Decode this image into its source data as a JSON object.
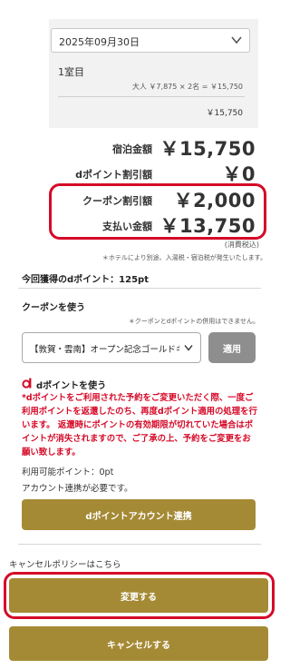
{
  "stay": {
    "date": "2025年09月30日",
    "room": "1室目",
    "price_detail": "大人 ￥7,875 × 2名 = ￥15,750",
    "subtotal": "￥15,750"
  },
  "totals": {
    "accommodation_label": "宿泊金額",
    "accommodation_value": "￥15,750",
    "dpoint_discount_label": "dポイント割引額",
    "dpoint_discount_value": "￥0",
    "coupon_discount_label": "クーポン割引額",
    "coupon_discount_value": "￥2,000",
    "payment_label": "支払い金額",
    "payment_value": "￥13,750",
    "tax_note": "(消費税込)",
    "hotel_note": "＊ホテルにより別途、入湯税・宿泊税が発生いたします。"
  },
  "points_earned": "今回獲得のdポイント：125pt",
  "coupon": {
    "title": "クーポンを使う",
    "note": "＊クーポンとdポイントの併用はできません。",
    "selected": "【敦賀・雲南】オープン記念ゴールドキャンペーン",
    "apply_label": "適用"
  },
  "dpoint": {
    "title": "dポイントを使う",
    "warning": "*dポイントをご利用された予約をご変更いただく際、一度ご利用ポイントを返還したのち、再度dポイント適用の処理を行います。 返還時にポイントの有効期限が切れていた場合はポイントが消失されますので、ご了承の上、予約をご変更をお願い致します。",
    "available": "利用可能ポイント：0pt",
    "link_required": "アカウント連携が必要です。",
    "link_button": "dポイントアカウント連携"
  },
  "policy_link": "キャンセルポリシーはこちら",
  "actions": {
    "change": "変更する",
    "cancel": "キャンセルする"
  },
  "colors": {
    "accent_gold": "#a58a35",
    "highlight_red": "#d50a28",
    "apply_gray": "#8e8e8e"
  },
  "icons": {
    "date_dropdown": "chevron-down-icon",
    "coupon_dropdown": "chevron-down-icon",
    "dpoint_logo": "d-logo-icon"
  }
}
